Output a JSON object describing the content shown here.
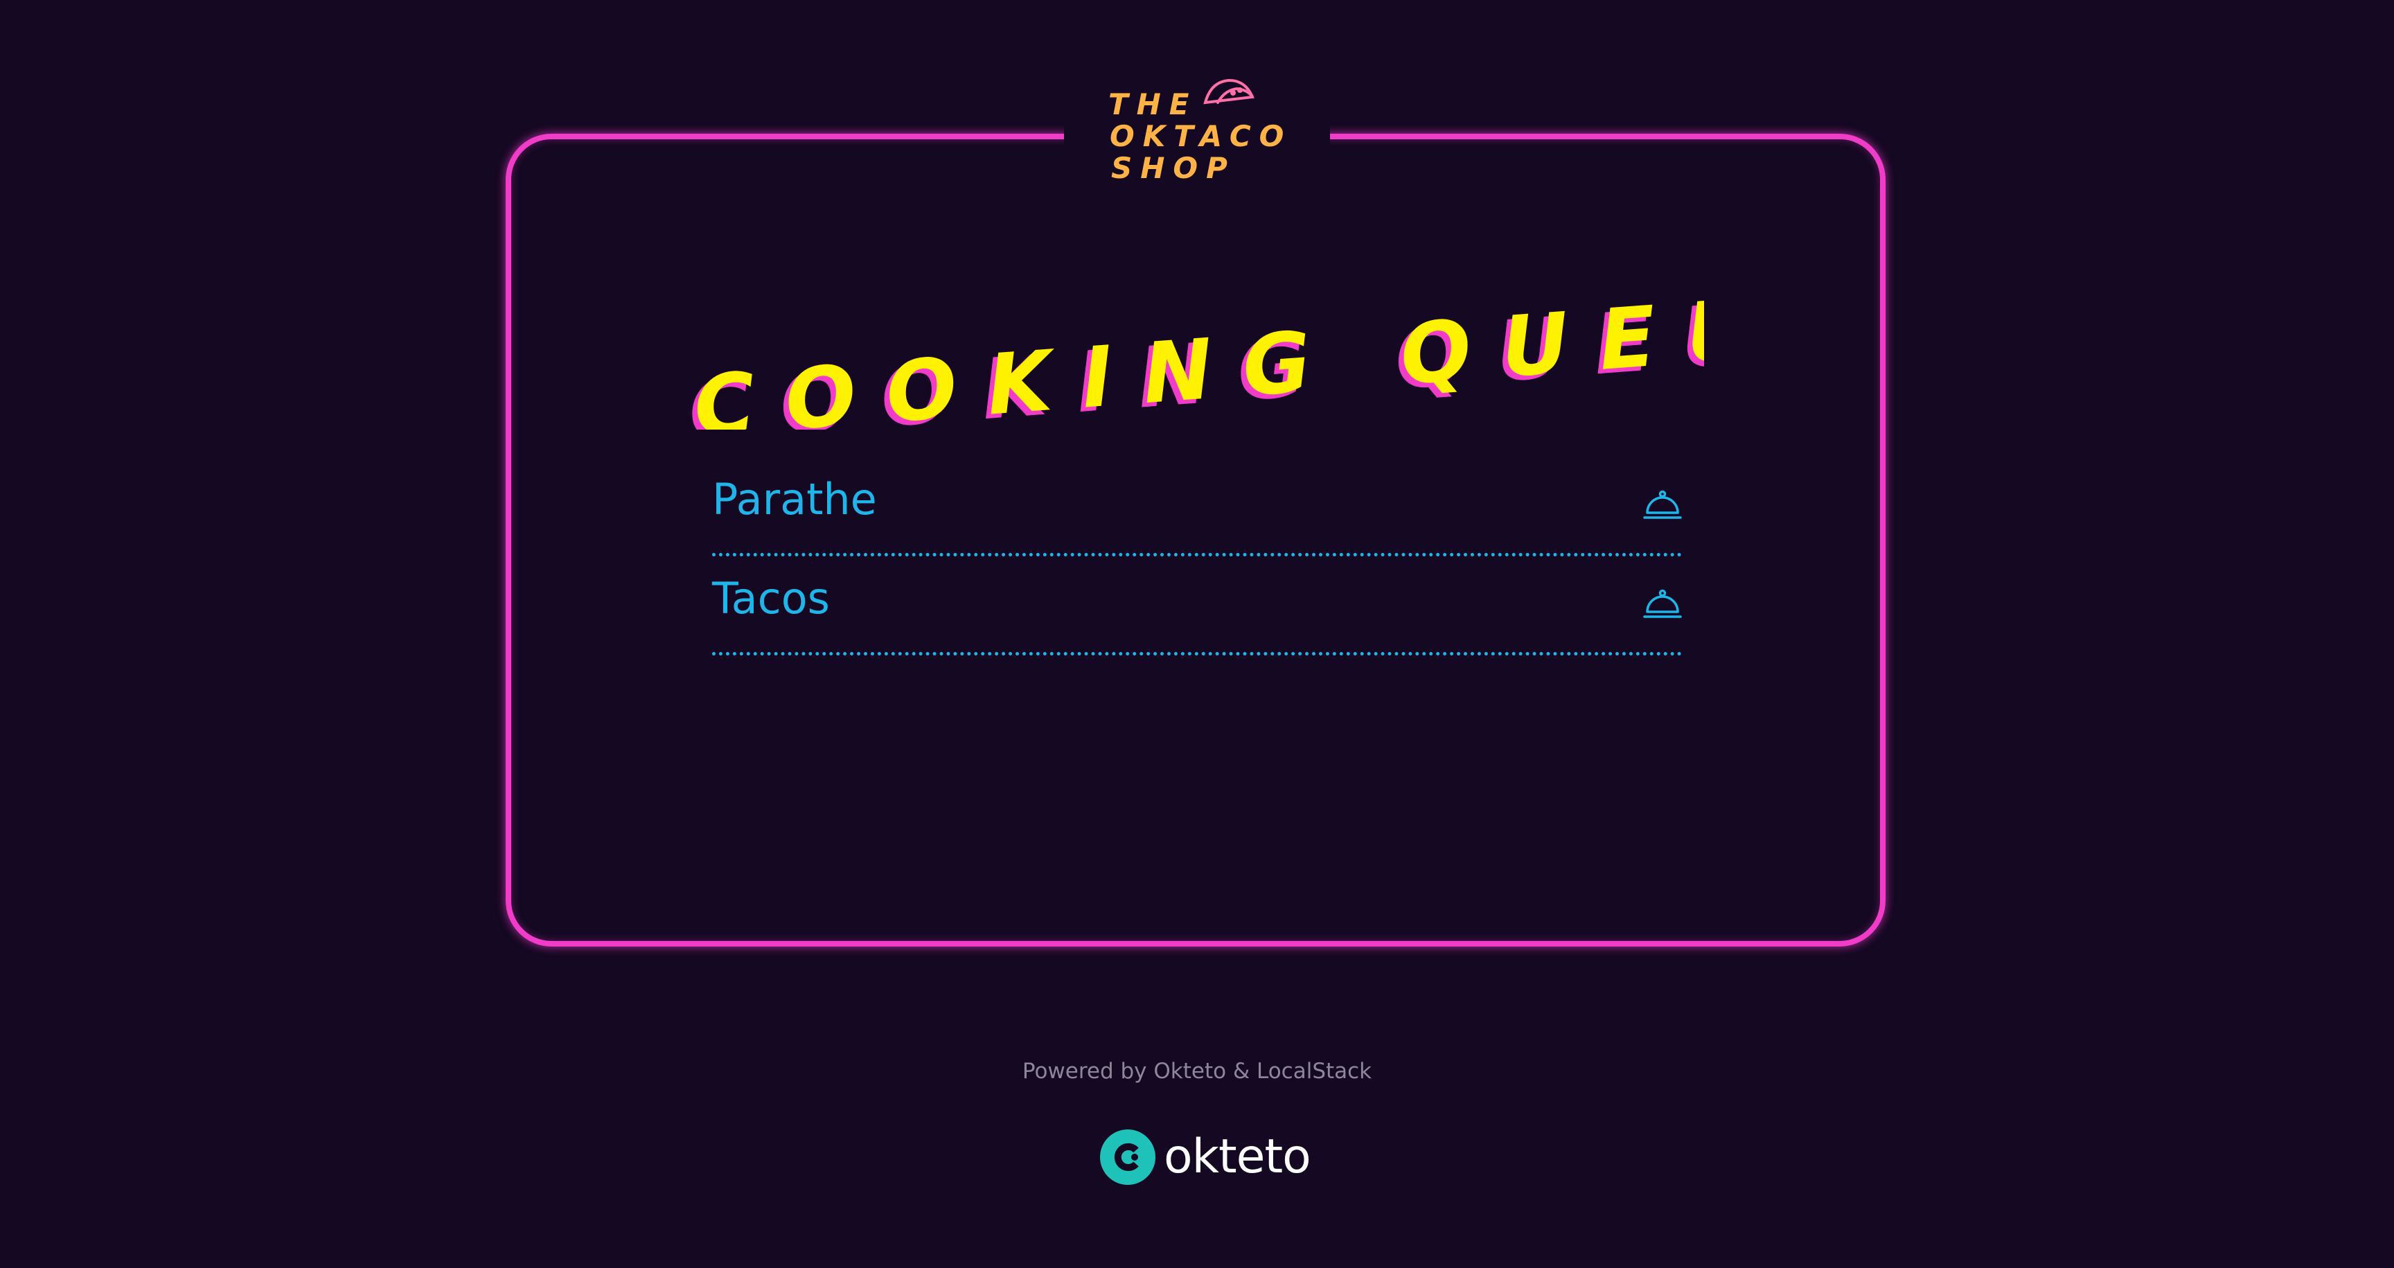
{
  "logo": {
    "line1": "THE",
    "line2": "OKTACO",
    "line3": "SHOP"
  },
  "headline": "COOKING QUEUE",
  "queue": {
    "items": [
      {
        "label": "Parathe",
        "icon": "cloche-icon"
      },
      {
        "label": "Tacos",
        "icon": "cloche-icon"
      }
    ]
  },
  "footer": {
    "powered_by": "Powered by Okteto & LocalStack",
    "brand_name": "okteto"
  },
  "colors": {
    "background": "#140822",
    "neon_pink": "#f03cc9",
    "neon_yellow": "#fff200",
    "logo_orange": "#ffb347",
    "item_blue": "#1fb5e8",
    "brand_teal": "#1ec2b8",
    "footer_gray": "#8d8799"
  }
}
